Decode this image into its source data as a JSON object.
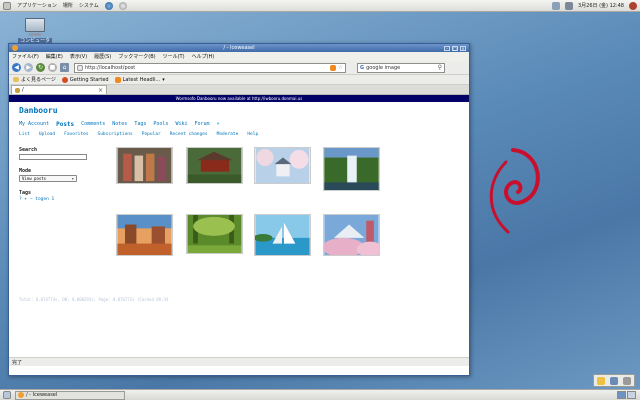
{
  "top_panel": {
    "applications": "アプリケーション",
    "places": "場所",
    "system": "システム",
    "clock": "3月26日 (金) 12:48"
  },
  "desktop": {
    "icon_label": "コンピュータ"
  },
  "window": {
    "title": "/ - Iceweasel",
    "menu": [
      "ファイル(F)",
      "編集(E)",
      "表示(V)",
      "履歴(S)",
      "ブックマーク(B)",
      "ツール(T)",
      "ヘルプ(H)"
    ],
    "url": "http://localhost/post",
    "search_engine": "G",
    "search_value": "google image",
    "bookmarks": [
      "よく見るページ",
      "Getting Started",
      "Latest Headli..."
    ],
    "tab_label": "/",
    "status": "完了"
  },
  "page": {
    "notice": "Wormsofo Danbooru now available at http://iwbooru.donmai.us",
    "site_title": "Danbooru",
    "main_nav": [
      "My Account",
      "Posts",
      "Comments",
      "Notes",
      "Tags",
      "Pools",
      "Wiki",
      "Forum",
      "»"
    ],
    "sub_nav": [
      "List",
      "Upload",
      "Favorites",
      "Subscriptions",
      "Popular",
      "Recent changes",
      "Moderate",
      "Help"
    ],
    "search_heading": "Search",
    "mode_heading": "Mode",
    "mode_value": "View posts",
    "tags_heading": "Tags",
    "tag_entry": "? + – togen 1",
    "footer": "Total: 0.074774s, DB: 0.008293s; Page: 0.076772s (Cached 09:34"
  },
  "thumbnails": [
    {
      "subject": "geisha",
      "colors": [
        "#7a6a58",
        "#b85a48",
        "#d8c0a8"
      ]
    },
    {
      "subject": "temple",
      "colors": [
        "#3a5a2a",
        "#8a2a1a",
        "#5a7a3a"
      ]
    },
    {
      "subject": "cherry-blossom-castle",
      "colors": [
        "#b8d0e8",
        "#f0d8e0",
        "#e8e8f0"
      ]
    },
    {
      "subject": "waterfall",
      "colors": [
        "#3a6a2a",
        "#e8f0f8",
        "#5a8a3a"
      ]
    },
    {
      "subject": "desert",
      "colors": [
        "#d88a48",
        "#8a4a2a",
        "#c0602a"
      ]
    },
    {
      "subject": "forest",
      "colors": [
        "#5a8a2a",
        "#9ac050",
        "#3a6a1a"
      ]
    },
    {
      "subject": "sailboat",
      "colors": [
        "#2a98c8",
        "#88d0e8",
        "#ffffff"
      ]
    },
    {
      "subject": "pagoda-fuji",
      "colors": [
        "#7aa8d8",
        "#e8b0c8",
        "#c05a6a"
      ]
    }
  ],
  "taskbar": {
    "task_label": "/ - Iceweasel"
  }
}
